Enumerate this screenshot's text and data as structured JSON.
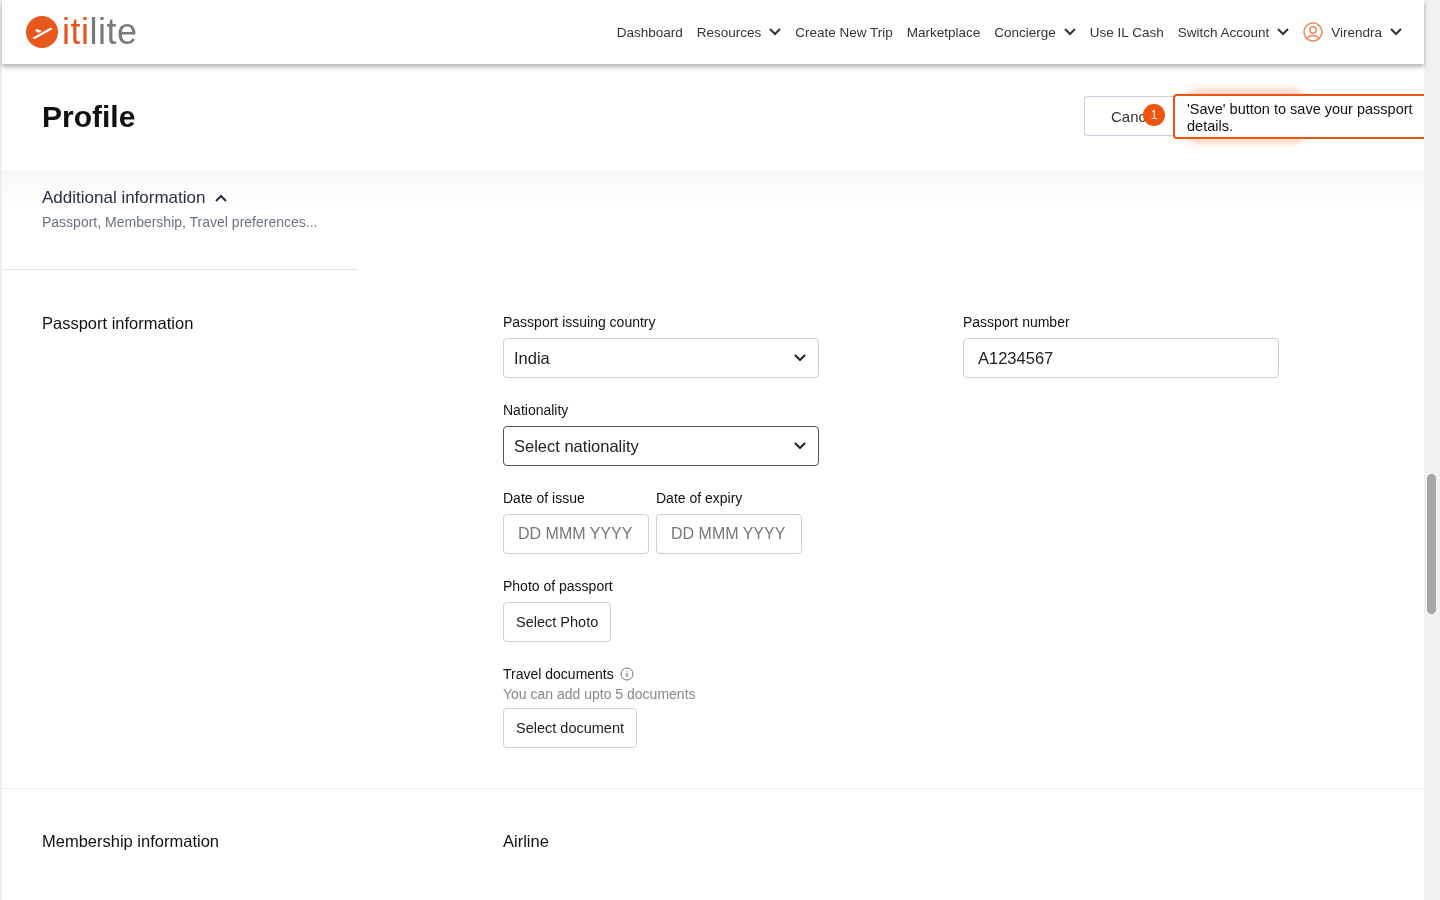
{
  "nav": {
    "logo": {
      "part_1": "iti",
      "part_2": "lite"
    },
    "items": [
      {
        "label": "Dashboard",
        "dropdown": false
      },
      {
        "label": "Resources",
        "dropdown": true
      },
      {
        "label": "Create New Trip",
        "dropdown": false
      },
      {
        "label": "Marketplace",
        "dropdown": false
      },
      {
        "label": "Concierge",
        "dropdown": true
      },
      {
        "label": "Use IL Cash",
        "dropdown": false
      },
      {
        "label": "Switch Account",
        "dropdown": true
      }
    ],
    "user": {
      "name": "Virendra",
      "dropdown": true
    }
  },
  "header": {
    "title": "Profile",
    "cancel_button": "Canc"
  },
  "tooltip": {
    "step": "1",
    "text": "'Save' button to save your passport details."
  },
  "additional": {
    "title": "Additional information",
    "expanded": true,
    "subtitle": "Passport, Membership, Travel preferences..."
  },
  "passport": {
    "title": "Passport information",
    "fields": [
      {
        "kind": "select",
        "label": "Passport issuing country",
        "value": "India",
        "focused": false
      },
      {
        "kind": "text",
        "label": "Passport number",
        "value": "A1234567"
      },
      {
        "kind": "select",
        "label": "Nationality",
        "value": "Select nationality",
        "focused": true
      },
      {
        "kind": "date",
        "label": "Date of issue",
        "placeholder": "DD MMM YYYY"
      },
      {
        "kind": "date",
        "label": "Date of expiry",
        "placeholder": "DD MMM YYYY"
      },
      {
        "kind": "upload",
        "label": "Photo of passport",
        "button": "Select Photo"
      },
      {
        "kind": "upload",
        "label": "Travel documents",
        "info": true,
        "hint": "You can add upto 5 documents",
        "button": "Select document"
      }
    ]
  },
  "membership": {
    "title": "Membership information",
    "label": "Airline"
  }
}
